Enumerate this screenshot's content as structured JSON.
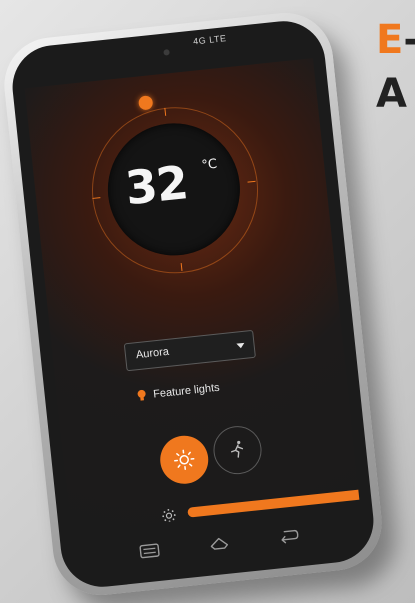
{
  "headline": {
    "accent_letter": "E",
    "rest": "-",
    "line2": "A"
  },
  "status_bar": {
    "network": "4G LTE"
  },
  "thermostat": {
    "temperature": "32",
    "unit": "°C"
  },
  "mode_dropdown": {
    "selected": "Aurora"
  },
  "feature": {
    "label": "Feature lights"
  },
  "sliders": [
    {
      "icon": "sun-dim-icon",
      "level": 1.0
    },
    {
      "icon": "sun-dim-icon",
      "level": 1.0
    }
  ],
  "colors": {
    "accent": "#f0781e",
    "screen_bg": "#1b1b1b",
    "text": "#e8e8e8"
  },
  "navbar": {
    "icons": [
      "recent-apps-icon",
      "home-icon",
      "back-icon"
    ]
  }
}
